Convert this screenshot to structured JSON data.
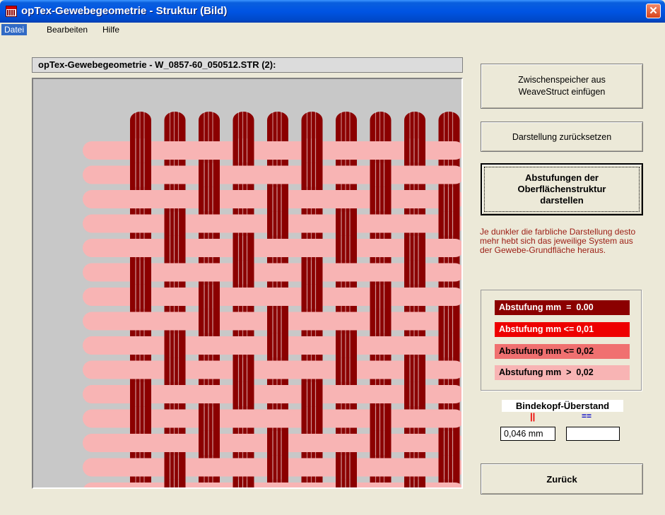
{
  "window": {
    "title": "opTex-Gewebegeometrie - Struktur (Bild)",
    "close_label": "✕"
  },
  "menu": {
    "items": [
      "Datei",
      "Bearbeiten",
      "Hilfe"
    ]
  },
  "structure": {
    "caption": "opTex-Gewebegeometrie - W_0857-60_050512.STR (2):"
  },
  "buttons": {
    "paste": [
      "Zwischenspeicher aus",
      "WeaveStruct einfügen"
    ],
    "reset": "Darstellung zurücksetzen",
    "gradations": [
      "Abstufungen der",
      "Oberflächenstruktur",
      "darstellen"
    ],
    "back": "Zurück"
  },
  "info_text": "Je dunkler die farbliche Darstellung desto mehr hebt sich das jeweilige System aus der Gewebe-Grundfläche heraus.",
  "legend": [
    {
      "label": "Abstufung mm  =  0.00",
      "bg": "#8b0000",
      "fg": "#ffffff"
    },
    {
      "label": "Abstufung mm <= 0,01",
      "bg": "#ee0000",
      "fg": "#ffffff"
    },
    {
      "label": "Abstufung mm <= 0,02",
      "bg": "#f07070",
      "fg": "#000000"
    },
    {
      "label": "Abstufung mm  >  0,02",
      "bg": "#f8b4b4",
      "fg": "#000000"
    }
  ],
  "binding_head": {
    "title": "Bindekopf-Überstand",
    "warp_symbol": "||",
    "weft_symbol": "==",
    "warp_value": "0,046 mm",
    "weft_value": ""
  },
  "colors": {
    "warp": "#8b0000",
    "weft": "#f8b4b4",
    "background": "#c8c8c8",
    "title_bar": "#0054e3"
  }
}
